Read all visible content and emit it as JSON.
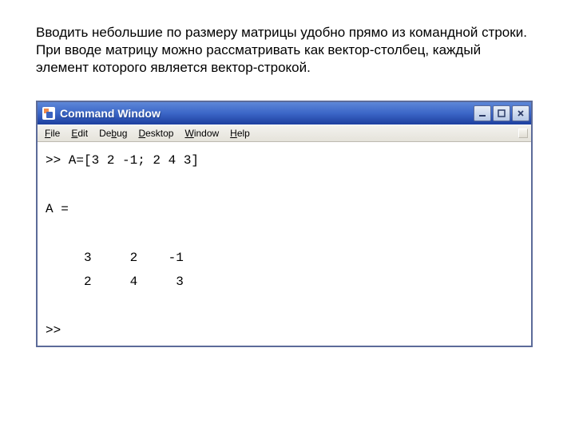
{
  "intro_text": "Вводить небольшие по размеру матрицы удобно прямо из командной строки. При вводе матрицу можно рассматривать как вектор-столбец, каждый элемент которого является вектор-строкой.",
  "window": {
    "title": "Command Window",
    "menu": {
      "file": {
        "pre": "",
        "u": "F",
        "rest": "ile"
      },
      "edit": {
        "pre": "",
        "u": "E",
        "rest": "dit"
      },
      "debug": {
        "pre": "De",
        "u": "b",
        "rest": "ug"
      },
      "desktop": {
        "pre": "",
        "u": "D",
        "rest": "esktop"
      },
      "window": {
        "pre": "",
        "u": "W",
        "rest": "indow"
      },
      "help": {
        "pre": "",
        "u": "H",
        "rest": "elp"
      }
    },
    "console_text": ">> A=[3 2 -1; 2 4 3]\n\nA =\n\n     3     2    -1\n     2     4     3\n\n>>"
  }
}
